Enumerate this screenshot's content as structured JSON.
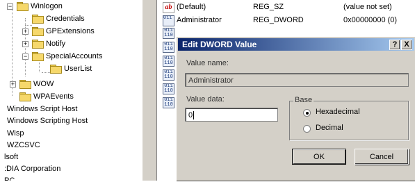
{
  "tree": {
    "items": [
      {
        "label": "Winlogon",
        "expander": "−"
      },
      {
        "label": "Credentials",
        "expander": ""
      },
      {
        "label": "GPExtensions",
        "expander": "+"
      },
      {
        "label": "Notify",
        "expander": "+"
      },
      {
        "label": "SpecialAccounts",
        "expander": "−"
      },
      {
        "label": "UserList",
        "expander": ""
      },
      {
        "label": "WOW",
        "expander": "+"
      },
      {
        "label": "WPAEvents",
        "expander": ""
      },
      {
        "label": "Windows Script Host"
      },
      {
        "label": "Windows Scripting Host"
      },
      {
        "label": "Wisp"
      },
      {
        "label": "WZCSVC"
      },
      {
        "label": "lsoft"
      },
      {
        "label": ":DIA Corporation"
      },
      {
        "label": "PC"
      }
    ]
  },
  "values_list": {
    "rows": [
      {
        "icon": "string-value-icon",
        "icon_text": "ab",
        "name": "(Default)",
        "type": "REG_SZ",
        "data": "(value not set)"
      },
      {
        "icon": "dword-value-icon",
        "icon_text": "011\n110",
        "name": "Administrator",
        "type": "REG_DWORD",
        "data": "0x00000000 (0)"
      }
    ],
    "extra_dword_icons": 6
  },
  "dialog": {
    "title": "Edit DWORD Value",
    "help_button": "?",
    "close_button": "X",
    "value_name_label": "Value name:",
    "value_name": "Administrator",
    "value_data_label": "Value data:",
    "value_data": "0",
    "base_label": "Base",
    "radio_hex": "Hexadecimal",
    "radio_dec": "Decimal",
    "selected_base": "Hexadecimal",
    "ok_label": "OK",
    "cancel_label": "Cancel"
  }
}
